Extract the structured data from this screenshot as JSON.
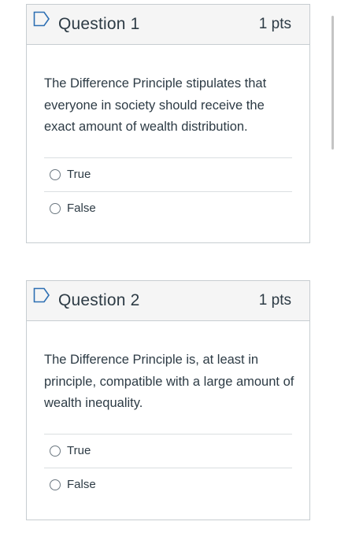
{
  "questions": [
    {
      "title": "Question 1",
      "points": "1 pts",
      "text": "The Difference Principle stipulates that everyone in society should receive the exact amount of wealth distribution.",
      "answers": [
        "True",
        "False"
      ]
    },
    {
      "title": "Question 2",
      "points": "1 pts",
      "text": "The Difference Principle is, at least in principle, compatible with a large amount of wealth inequality.",
      "answers": [
        "True",
        "False"
      ]
    }
  ],
  "icons": {
    "flag": "flag-icon",
    "radio": "radio-icon"
  },
  "colors": {
    "header_bg": "#f5f5f5",
    "border": "#c7cdd1",
    "text": "#2d3b45",
    "flag_stroke": "#2d6fb3"
  }
}
